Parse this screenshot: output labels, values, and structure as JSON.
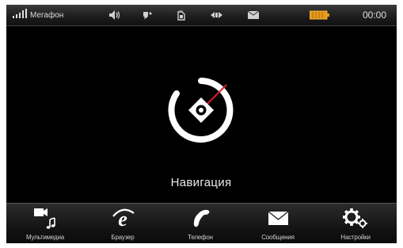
{
  "status_bar": {
    "carrier": "Мегафон",
    "time": "00:00",
    "icons": [
      "signal-icon",
      "volume-icon",
      "bluetooth-icon",
      "sim-card-icon",
      "gps-icon",
      "message-envelope-icon",
      "battery-icon"
    ],
    "colors": {
      "battery": "#e69a1c",
      "text": "#dcdcdc"
    }
  },
  "main": {
    "app_label": "Навигация",
    "app_icon": "compass-icon",
    "colors": {
      "needle_north": "#d81e2a",
      "needle_south": "#ffffff"
    }
  },
  "dock": {
    "items": [
      {
        "label": "Мультимедиа",
        "icon": "multimedia-icon"
      },
      {
        "label": "Браузер",
        "icon": "browser-icon"
      },
      {
        "label": "Телефон",
        "icon": "phone-icon"
      },
      {
        "label": "Сообщения",
        "icon": "messages-icon"
      },
      {
        "label": "Настройки",
        "icon": "settings-icon"
      }
    ]
  }
}
